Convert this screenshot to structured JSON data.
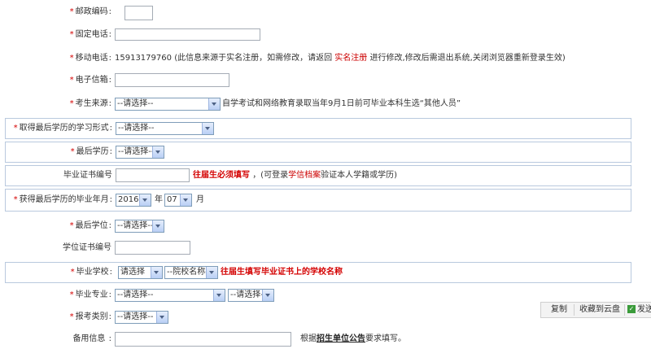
{
  "rows": {
    "postal": {
      "label": "邮政编码"
    },
    "landline": {
      "label": "固定电话"
    },
    "mobile": {
      "label": "移动电话",
      "value": "15913179760",
      "note_pre": "(此信息来源于实名注册，如需修改，请返回",
      "link": "实名注册",
      "note_post": "进行修改,修改后需退出系统,关闭浏览器重新登录生效)"
    },
    "email": {
      "label": "电子信箱"
    },
    "source": {
      "label": "考生来源",
      "select": "--请选择--",
      "note": "自学考试和网络教育录取当年9月1日前可毕业本科生选“其他人员”"
    },
    "study_form": {
      "label": "取得最后学历的学习形式",
      "select": "--请选择--"
    },
    "last_degree": {
      "label": "最后学历",
      "select": "--请选择--"
    },
    "cert_no": {
      "label": "毕业证书编号",
      "note_red": "往届生必须填写",
      "note_pre": "，(可登录",
      "link": "学信档案",
      "note_post": "验证本人学籍或学历)"
    },
    "grad_date": {
      "label": "获得最后学历的毕业年月",
      "year": "2016",
      "year_unit": "年",
      "month": "07",
      "month_unit": "月"
    },
    "last_degree_title": {
      "label": "最后学位",
      "select": "--请选择--"
    },
    "degree_cert": {
      "label": "学位证书编号"
    },
    "school": {
      "label": "毕业学校",
      "select1": "请选择",
      "select2": "--院校名称--",
      "note_red": "往届生填写毕业证书上的学校名称"
    },
    "major": {
      "label": "毕业专业",
      "select1": "--请选择--",
      "select2": "--请选择--"
    },
    "exam_type": {
      "label": "报考类别",
      "select": "--请选择--"
    },
    "backup": {
      "label": "备用信息",
      "note_pre": "根据",
      "link": "招生单位公告",
      "note_post": "要求填写。"
    }
  },
  "popup": {
    "copy": "复制",
    "cloud": "收藏到云盘",
    "send": "发送"
  },
  "colors": {
    "required": "#d40000",
    "border": "#b9c9de"
  }
}
